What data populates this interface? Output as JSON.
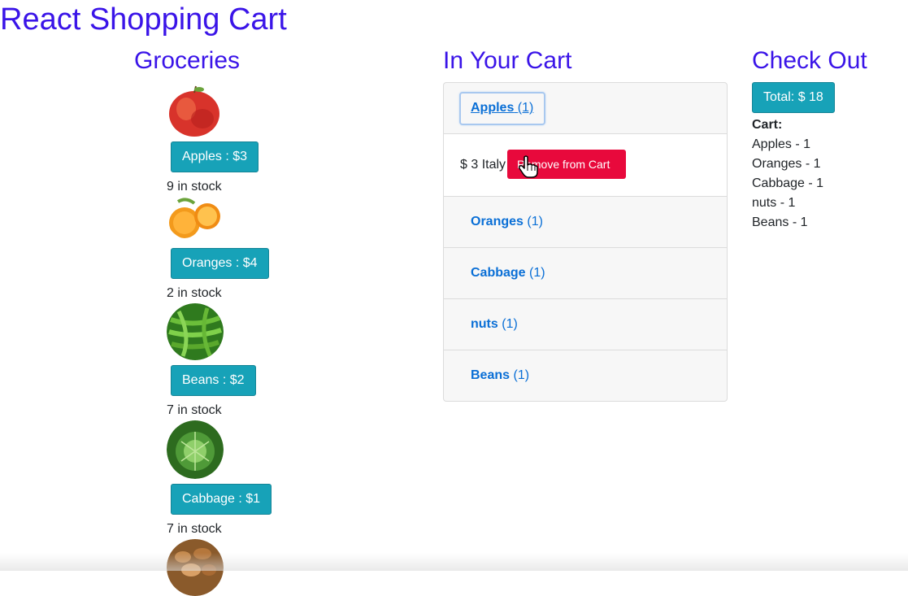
{
  "page": {
    "title": "React Shopping Cart"
  },
  "columns": {
    "groceries": "Groceries",
    "cart": "In Your Cart",
    "checkout": "Check Out"
  },
  "groceries": [
    {
      "name": "Apples",
      "button": "Apples : $3",
      "stock": "9 in stock",
      "icon": "apple-image"
    },
    {
      "name": "Oranges",
      "button": "Oranges : $4",
      "stock": "2 in stock",
      "icon": "orange-image"
    },
    {
      "name": "Beans",
      "button": "Beans : $2",
      "stock": "7 in stock",
      "icon": "beans-image"
    },
    {
      "name": "Cabbage",
      "button": "Cabbage : $1",
      "stock": "7 in stock",
      "icon": "cabbage-image"
    },
    {
      "name": "nuts",
      "icon": "nuts-image"
    }
  ],
  "cart": {
    "items": [
      {
        "name": "Apples",
        "count": "(1)"
      },
      {
        "name": "Oranges",
        "count": "(1)"
      },
      {
        "name": "Cabbage",
        "count": "(1)"
      },
      {
        "name": "nuts",
        "count": "(1)"
      },
      {
        "name": "Beans",
        "count": "(1)"
      }
    ],
    "expanded": {
      "detail": "$ 3 Italy",
      "remove_label": "Remove from Cart"
    }
  },
  "checkout": {
    "total_label": "Total: $ 18",
    "cart_label": "Cart:",
    "lines": [
      "Apples - 1",
      "Oranges - 1",
      "Cabbage - 1",
      "nuts - 1",
      "Beans - 1"
    ]
  },
  "colors": {
    "heading": "#3a14e8",
    "info": "#17a2b8",
    "danger": "#e8093c",
    "link": "#0a6fd6"
  }
}
